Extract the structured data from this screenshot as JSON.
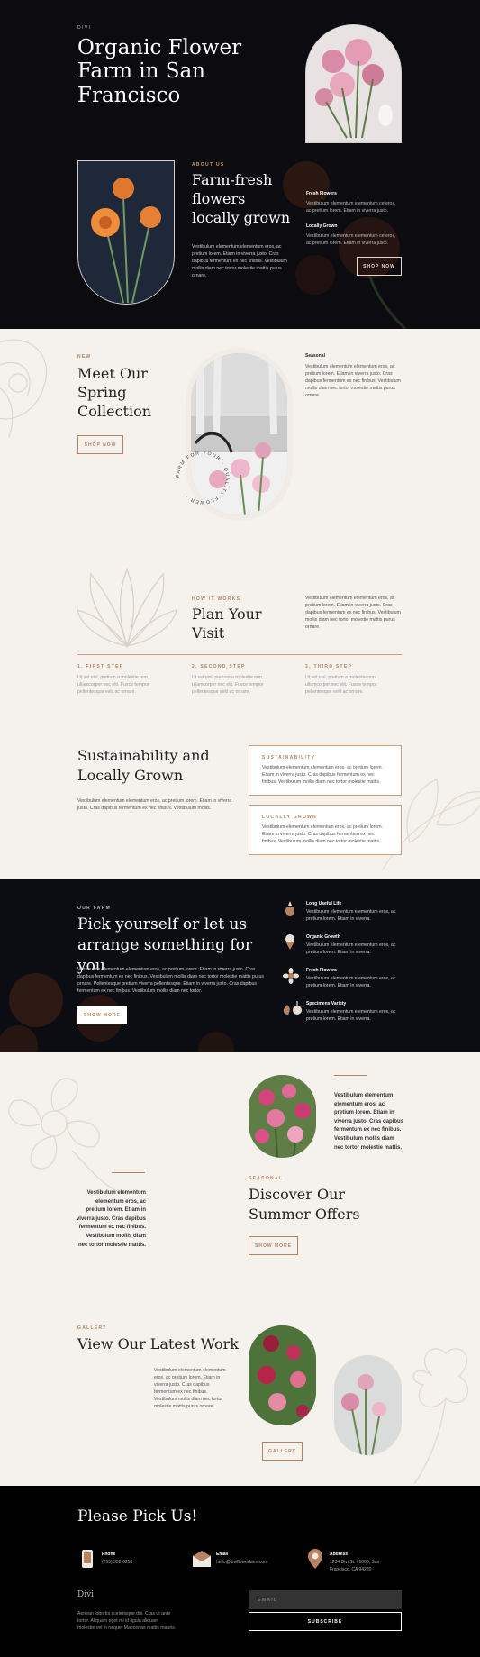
{
  "colors": {
    "accent": "#b7825e",
    "dark": "#0c0c10",
    "cream": "#f5f2ee"
  },
  "hero": {
    "brand": "DIVI",
    "title": "Organic Flower Farm in San Francisco",
    "about_eyebrow": "ABOUT US",
    "about_title": "Farm-fresh flowers locally grown",
    "about_text": "Vestibulum elementum elementum eros, ac pretium lorem. Etiam in viverra justo. Cras dapibus fermentum ex nec finibus. Vestibulum mollis diam nec tortor molestie mattis purus ornare.",
    "features": [
      {
        "title": "Fresh Flowers",
        "text": "Vestibulum elementum elementum ceteros, ac pretium lorem. Etiam in viverra justo."
      },
      {
        "title": "Locally Grown",
        "text": "Vestibulum elementum elementum ceteros, ac pretium lorem. Etiam in viverra justo."
      }
    ],
    "shop_button": "SHOP NOW"
  },
  "collection": {
    "eyebrow": "NEW",
    "title": "Meet Our Spring Collection",
    "button": "SHOP NOW",
    "badge_text": "FARM FOR YOUR · QUALITY FLOWER ·",
    "side_title": "Seasonal",
    "side_text": "Vestibulum elementum elementum eros, ac pretium lorem. Etiam in viverra justo. Cras dapibus fermentum ex nec finibus. Vestibulum mollis diam nec tortor molestie mattis purus ornare."
  },
  "how": {
    "eyebrow": "HOW IT WORKS",
    "title": "Plan Your Visit",
    "text": "Vestibulum elementum elementum eros, ac pretium lorem. Etiam in viverra justo. Cras dapibus fermentum ex nec finibus. Vestibulum mollis diam nec tortor molestie mattis purus ornare.",
    "steps": [
      {
        "title": "1. FIRST STEP",
        "text": "Ut vel nisl, pretium a molestie non, ullamcorper nec elit. Fusce tempor pellentesque velit ac ornare."
      },
      {
        "title": "2. SECOND STEP",
        "text": "Ut vel nisl, pretium a molestie non, ullamcorper nec elit. Fusce tempor pellentesque velit ac ornare."
      },
      {
        "title": "3. THIRD STEP",
        "text": "Ut vel nisl, pretium a molestie non, ullamcorper nec elit. Fusce tempor pellentesque velit ac ornare."
      }
    ]
  },
  "sustain": {
    "title": "Sustainability and Locally Grown",
    "text": "Vestibulum elementum elementum eros, ac pretium lorem. Etiam in viverra justo. Cras dapibus fermentum ex nec finibus. Vestibulum mollis.",
    "boxes": [
      {
        "title": "SUSTAINABILITY",
        "text": "Vestibulum elementum elementum eros, ac pretium lorem. Etiam in viverra justo. Cras dapibus fermentum ex nec finibus. Vestibulum mollis diam nec tortor molestie mattis."
      },
      {
        "title": "LOCALLY GROWN",
        "text": "Vestibulum elementum elementum eros, ac pretium lorem. Etiam in viverra justo. Cras dapibus fermentum ex nec finibus. Vestibulum mollis diam nec tortor molestie mattis."
      }
    ]
  },
  "farm": {
    "eyebrow": "OUR FARM",
    "title": "Pick yourself or let us arrange something for you",
    "text": "Vestibulum elementum elementum eros, ac pretium lorem. Etiam in viverra justo. Cras dapibus fermentum ex nec finibus. Vestibulum mollis diam nec tortor molestie mattis purus ornare. Pellentesque pretium viverra pellentesque. Etiam in viverra justo. Cras dapibus fermentum ex nec finibus. Vestibulum mollis diam nec tortor.",
    "button": "SHOW MORE",
    "items": [
      {
        "title": "Long Useful Life",
        "text": "Vestibulum elementum elementum eros, ac pretium lorem. Etiam in viverra.",
        "icon": "vase-icon"
      },
      {
        "title": "Organic Growth",
        "text": "Vestibulum elementum elementum eros, ac pretium lorem. Etiam in viverra.",
        "icon": "bouquet-icon"
      },
      {
        "title": "Fresh Flowers",
        "text": "Vestibulum elementum elementum eros, ac pretium lorem. Etiam in viverra.",
        "icon": "flower-icon"
      },
      {
        "title": "Specimens Variety",
        "text": "Vestibulum elementum elementum eros, ac pretium lorem. Etiam in viverra.",
        "icon": "bulbs-icon"
      }
    ]
  },
  "offers": {
    "quote_right": "Vestibulum elementum elementum eros, ac pretium lorem. Etiam in viverra justo. Cras dapibus fermentum ex nec finibus. Vestibulum mollis diam nec tortor molestie mattis.",
    "quote_left": "Vestibulum elementum elementum eros, ac pretium lorem. Etiam in viverra justo. Cras dapibus fermentum ex nec finibus. Vestibulum mollis diam nec tortor molestie mattis.",
    "eyebrow": "SEASONAL",
    "title": "Discover Our Summer Offers",
    "button": "SHOW MORE"
  },
  "gallery": {
    "eyebrow": "GALLERY",
    "title": "View Our Latest Work",
    "text": "Vestibulum elementum elementum eros, ac pretium lorem. Etiam in viverra justo. Cras dapibus fermentum ex nec finibus. Vestibulum mollis diam nec tortor molestie mattis purus ornare.",
    "button": "GALLERY"
  },
  "footer": {
    "title": "Please Pick Us!",
    "contacts": [
      {
        "label": "Phone",
        "value": "(255) 352-6258",
        "icon": "phone-icon"
      },
      {
        "label": "Email",
        "value": "hello@diviflowerfarm.com",
        "icon": "email-icon"
      },
      {
        "label": "Address",
        "value": "1234 Divi St. #1000, San Francisco, CA 94220",
        "icon": "location-icon"
      }
    ],
    "brand": "Divi",
    "brand_text": "Aenean lobortis scelerisque dui. Cras ut ante tortor. Aliquam eget mi id ligula aliquam molestie vel in neque. Maecenas mattis mauris.",
    "email_placeholder": "EMAIL",
    "subscribe": "SUBSCRIBE"
  }
}
